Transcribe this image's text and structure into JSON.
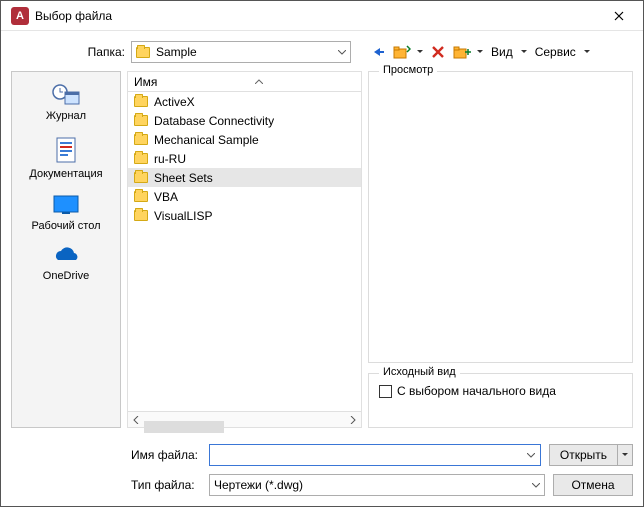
{
  "window": {
    "title": "Выбор файла"
  },
  "folder_row": {
    "label": "Папка:",
    "value": "Sample"
  },
  "toolbar_menus": {
    "view": "Вид",
    "tools": "Сервис"
  },
  "places": [
    {
      "id": "history",
      "label": "Журнал"
    },
    {
      "id": "docs",
      "label": "Документация"
    },
    {
      "id": "desktop",
      "label": "Рабочий стол"
    },
    {
      "id": "onedrive",
      "label": "OneDrive"
    }
  ],
  "list": {
    "header": "Имя",
    "items": [
      {
        "name": "ActiveX"
      },
      {
        "name": "Database Connectivity"
      },
      {
        "name": "Mechanical Sample"
      },
      {
        "name": "ru-RU"
      },
      {
        "name": "Sheet Sets",
        "selected": true
      },
      {
        "name": "VBA"
      },
      {
        "name": "VisualLISP"
      }
    ]
  },
  "preview": {
    "legend": "Просмотр"
  },
  "source_view": {
    "legend": "Исходный вид",
    "checkbox_label": "С выбором начального вида"
  },
  "bottom": {
    "filename_label": "Имя файла:",
    "filename_value": "",
    "filetype_label": "Тип файла:",
    "filetype_value": "Чертежи (*.dwg)",
    "open": "Открыть",
    "cancel": "Отмена"
  }
}
